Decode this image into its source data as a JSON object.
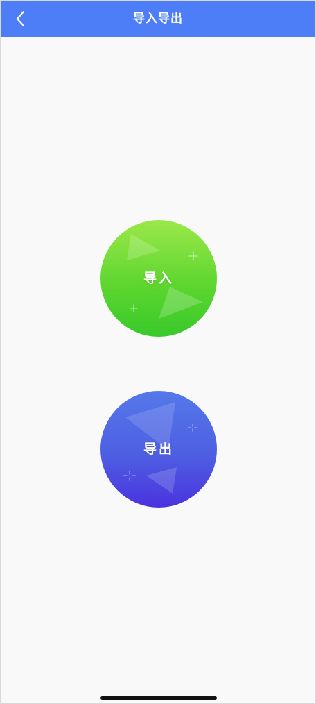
{
  "header": {
    "title": "导入导出",
    "back_icon": "chevron-left-icon",
    "background_color": "#4d7ef7"
  },
  "actions": {
    "import": {
      "label": "导入",
      "gradient": [
        "#9be84a",
        "#38c92a"
      ]
    },
    "export": {
      "label": "导出",
      "gradient": [
        "#5578ea",
        "#4a33df"
      ]
    }
  }
}
